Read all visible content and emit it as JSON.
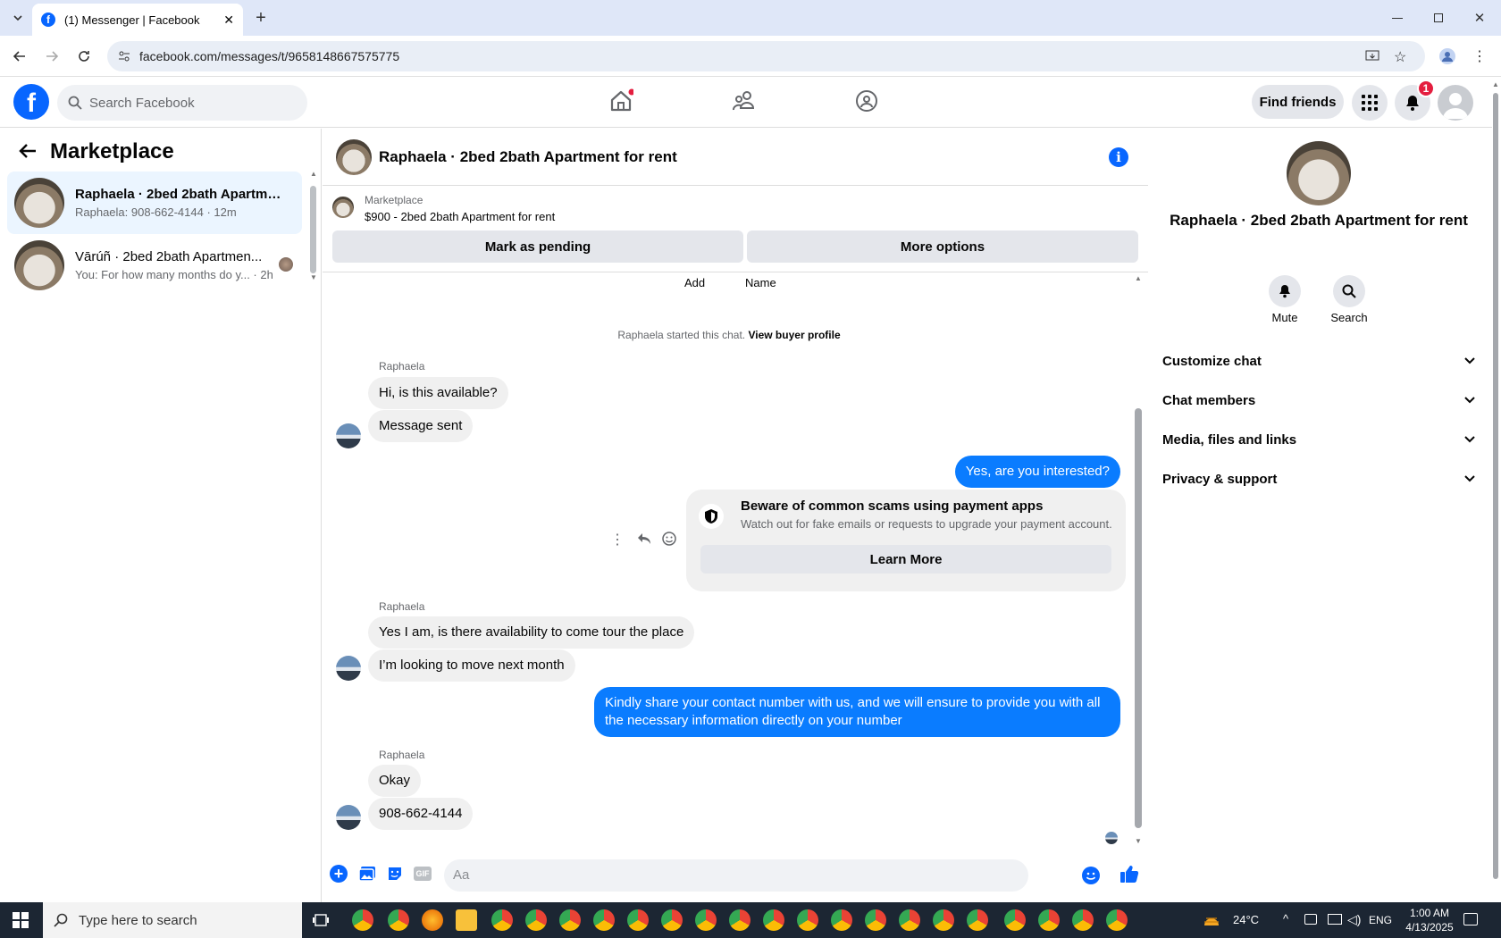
{
  "browser": {
    "tab_title": "(1) Messenger | Facebook",
    "url": "facebook.com/messages/t/9658148667575775"
  },
  "header": {
    "search_placeholder": "Search Facebook",
    "find_friends": "Find friends",
    "notif_count": "1"
  },
  "left": {
    "title": "Marketplace",
    "conversations": [
      {
        "name": "Raphaela · 2bed 2bath Apartme...",
        "preview": "Raphaela: 908-662-4144 · 12m"
      },
      {
        "name": "Vārúñ · 2bed 2bath Apartmen...",
        "preview": "You: For how many months do y... · 2h"
      }
    ]
  },
  "chat": {
    "title": "Raphaela · 2bed 2bath Apartment for rent",
    "listing_source": "Marketplace",
    "listing_price": "$900 - 2bed 2bath Apartment for rent",
    "mark_pending": "Mark as pending",
    "more_options": "More options",
    "add_label": "Add",
    "name_label": "Name",
    "started_text": "Raphaela started this chat.",
    "view_profile": "View buyer profile",
    "sender": "Raphaela",
    "msg1": "Hi, is this available?",
    "msg2": "Message sent",
    "msg3": "Yes, are you interested?",
    "scam_title": "Beware of common scams using payment apps",
    "scam_body": "Watch out for fake emails or requests to upgrade your payment account.",
    "learn_more": "Learn More",
    "msg4": "Yes I am, is there availability to come tour the place",
    "msg5": "I’m looking to move next month",
    "msg6": "Kindly share your contact number with us, and we will ensure to provide you with all the necessary information directly on your number",
    "msg7": "Okay",
    "msg8": "908-662-4144",
    "composer_placeholder": "Aa",
    "gif_label": "GIF"
  },
  "right": {
    "title": "Raphaela · 2bed 2bath Apartment for rent",
    "mute": "Mute",
    "search": "Search",
    "sections": [
      "Customize chat",
      "Chat members",
      "Media, files and links",
      "Privacy & support"
    ]
  },
  "taskbar": {
    "search_placeholder": "Type here to search",
    "temp": "24°C",
    "lang": "ENG",
    "time": "1:00 AM",
    "date": "4/13/2025"
  },
  "colors": {
    "accent": "#0866ff",
    "bubble_me": "#0a7cff",
    "notif": "#e41e3f"
  }
}
